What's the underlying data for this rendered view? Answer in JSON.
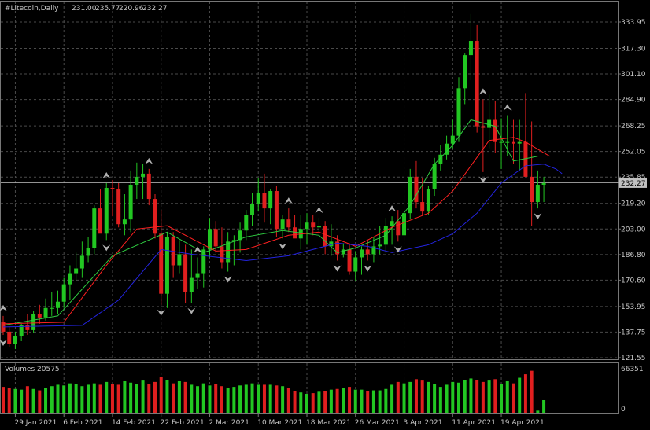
{
  "chart_data": {
    "type": "candlestick",
    "symbol_label": "#Litecoin,Daily",
    "ohlc_label": [
      "231.00",
      "235.77",
      "220.96",
      "232.27"
    ],
    "current_price_label": "232.27",
    "current_price": 232.27,
    "y_ticks": [
      "333.95",
      "317.30",
      "301.10",
      "284.90",
      "268.25",
      "252.05",
      "235.85",
      "219.20",
      "203.00",
      "186.80",
      "170.60",
      "153.95",
      "137.75",
      "121.55"
    ],
    "ylim": [
      121.55,
      333.95
    ],
    "x_labels": [
      "29 Jan 2021",
      "6 Feb 2021",
      "14 Feb 2021",
      "22 Feb 2021",
      "2 Mar 2021",
      "10 Mar 2021",
      "18 Mar 2021",
      "26 Mar 2021",
      "3 Apr 2021",
      "11 Apr 2021",
      "19 Apr 2021"
    ],
    "dates": [
      "2021-01-27",
      "2021-01-28",
      "2021-01-29",
      "2021-01-30",
      "2021-01-31",
      "2021-02-01",
      "2021-02-02",
      "2021-02-03",
      "2021-02-04",
      "2021-02-05",
      "2021-02-06",
      "2021-02-07",
      "2021-02-08",
      "2021-02-09",
      "2021-02-10",
      "2021-02-11",
      "2021-02-12",
      "2021-02-13",
      "2021-02-14",
      "2021-02-15",
      "2021-02-16",
      "2021-02-17",
      "2021-02-18",
      "2021-02-19",
      "2021-02-20",
      "2021-02-21",
      "2021-02-22",
      "2021-02-23",
      "2021-02-24",
      "2021-02-25",
      "2021-02-26",
      "2021-02-27",
      "2021-02-28",
      "2021-03-01",
      "2021-03-02",
      "2021-03-03",
      "2021-03-04",
      "2021-03-05",
      "2021-03-06",
      "2021-03-07",
      "2021-03-08",
      "2021-03-09",
      "2021-03-10",
      "2021-03-11",
      "2021-03-12",
      "2021-03-13",
      "2021-03-14",
      "2021-03-15",
      "2021-03-16",
      "2021-03-17",
      "2021-03-18",
      "2021-03-19",
      "2021-03-20",
      "2021-03-21",
      "2021-03-22",
      "2021-03-23",
      "2021-03-24",
      "2021-03-25",
      "2021-03-26",
      "2021-03-27",
      "2021-03-28",
      "2021-03-29",
      "2021-03-30",
      "2021-03-31",
      "2021-04-01",
      "2021-04-02",
      "2021-04-03",
      "2021-04-04",
      "2021-04-05",
      "2021-04-06",
      "2021-04-07",
      "2021-04-08",
      "2021-04-09",
      "2021-04-10",
      "2021-04-11",
      "2021-04-12",
      "2021-04-13",
      "2021-04-14",
      "2021-04-15",
      "2021-04-16",
      "2021-04-17",
      "2021-04-18",
      "2021-04-19",
      "2021-04-20",
      "2021-04-21",
      "2021-04-22",
      "2021-04-23",
      "2021-04-24",
      "2021-04-25",
      "2021-04-26"
    ],
    "open": [
      144,
      138,
      130,
      135,
      142,
      139,
      149,
      147,
      153,
      153,
      157,
      168,
      175,
      178,
      186,
      191,
      216,
      200,
      229,
      228,
      206,
      209,
      231,
      236,
      238,
      222,
      200,
      162,
      198,
      180,
      187,
      163,
      172,
      175,
      190,
      203,
      192,
      182,
      195,
      196,
      202,
      212,
      219,
      226,
      216,
      227,
      203,
      209,
      204,
      197,
      203,
      207,
      204,
      205,
      192,
      195,
      187,
      190,
      176,
      185,
      190,
      187,
      192,
      193,
      205,
      208,
      199,
      213,
      236,
      220,
      214,
      228,
      244,
      250,
      257,
      262,
      292,
      313,
      322,
      268,
      267,
      272,
      258,
      258,
      258,
      257,
      258,
      236,
      220,
      231
    ],
    "high": [
      148,
      141,
      138,
      143,
      149,
      151,
      155,
      159,
      163,
      164,
      172,
      180,
      188,
      195,
      198,
      218,
      228,
      232,
      234,
      232,
      225,
      240,
      245,
      244,
      241,
      225,
      215,
      201,
      201,
      196,
      193,
      190,
      185,
      192,
      210,
      208,
      204,
      201,
      199,
      207,
      215,
      226,
      235,
      238,
      228,
      230,
      212,
      216,
      212,
      212,
      213,
      212,
      210,
      208,
      206,
      199,
      194,
      194,
      189,
      192,
      196,
      198,
      205,
      210,
      211,
      215,
      224,
      241,
      246,
      235,
      230,
      248,
      256,
      262,
      272,
      299,
      314,
      339,
      332,
      285,
      288,
      284,
      273,
      275,
      272,
      272,
      289,
      271,
      240,
      236
    ],
    "low": [
      136,
      128,
      127,
      132,
      136,
      137,
      143,
      145,
      148,
      149,
      153,
      158,
      170,
      172,
      182,
      187,
      201,
      196,
      211,
      204,
      199,
      201,
      222,
      222,
      218,
      197,
      155,
      153,
      172,
      175,
      156,
      156,
      165,
      166,
      185,
      188,
      178,
      176,
      180,
      188,
      196,
      205,
      214,
      207,
      206,
      198,
      197,
      201,
      200,
      190,
      193,
      199,
      200,
      187,
      186,
      183,
      185,
      174,
      170,
      174,
      183,
      182,
      187,
      188,
      193,
      195,
      195,
      209,
      216,
      212,
      212,
      224,
      240,
      247,
      254,
      258,
      282,
      297,
      264,
      239,
      254,
      251,
      241,
      249,
      244,
      240,
      241,
      205,
      216,
      220
    ],
    "close": [
      138,
      130,
      135,
      142,
      139,
      149,
      147,
      153,
      153,
      157,
      168,
      175,
      178,
      186,
      191,
      216,
      200,
      229,
      228,
      206,
      209,
      231,
      236,
      238,
      222,
      200,
      162,
      198,
      180,
      187,
      163,
      172,
      175,
      190,
      203,
      192,
      182,
      195,
      196,
      202,
      212,
      219,
      226,
      216,
      227,
      203,
      209,
      204,
      197,
      203,
      207,
      204,
      205,
      192,
      195,
      187,
      190,
      176,
      185,
      190,
      187,
      192,
      193,
      205,
      208,
      199,
      213,
      236,
      220,
      214,
      228,
      244,
      250,
      257,
      262,
      292,
      313,
      322,
      268,
      267,
      272,
      258,
      258,
      258,
      257,
      258,
      236,
      220,
      231,
      232
    ],
    "ma_green": {
      "name": "",
      "color": "#2ecc40",
      "days": [
        0,
        9,
        18,
        27,
        33,
        40,
        46,
        52,
        55,
        58,
        63,
        67,
        71,
        74,
        77,
        81,
        84,
        88
      ],
      "values": [
        142,
        148,
        186,
        201,
        188,
        198,
        202,
        199,
        188,
        191,
        199,
        218,
        244,
        256,
        272,
        268,
        246,
        249
      ]
    },
    "ma_red": {
      "name": "",
      "color": "#ff2020",
      "days": [
        0,
        10,
        17,
        22,
        27,
        35,
        40,
        47,
        52,
        58,
        64,
        70,
        74,
        80,
        84,
        86,
        90
      ],
      "values": [
        143,
        144,
        180,
        203,
        205,
        189,
        190,
        199,
        201,
        192,
        204,
        213,
        227,
        259,
        261,
        258,
        249
      ]
    },
    "ma_blue": {
      "name": "",
      "color": "#2424e0",
      "days": [
        0,
        13,
        19,
        26,
        31,
        40,
        47,
        55,
        60,
        64,
        70,
        74,
        78,
        82,
        86,
        89,
        91,
        92
      ],
      "values": [
        141,
        142,
        158,
        190,
        187,
        183,
        186,
        194,
        192,
        188,
        193,
        200,
        213,
        232,
        243,
        244,
        241,
        238
      ]
    },
    "fractals_up_days": [
      0,
      17,
      24,
      32,
      47,
      52,
      64,
      79,
      83
    ],
    "fractals_down_days": [
      0,
      17,
      26,
      31,
      37,
      46,
      55,
      60,
      65,
      79,
      88
    ],
    "volume_label": "Volumes 20575",
    "volume_ticks": [
      "66351",
      "0"
    ],
    "volume_ylim": [
      0,
      66351
    ],
    "volumes": [
      37000,
      36000,
      34000,
      33000,
      38000,
      34000,
      32000,
      35000,
      38000,
      40000,
      39000,
      42000,
      41000,
      38000,
      40000,
      42000,
      40000,
      44000,
      41000,
      40000,
      45000,
      43000,
      41000,
      46000,
      41000,
      44000,
      51000,
      47000,
      42000,
      45000,
      44000,
      40000,
      38000,
      42000,
      39000,
      41000,
      38000,
      36000,
      37000,
      39000,
      40000,
      42000,
      40000,
      40000,
      40000,
      39000,
      38000,
      35000,
      31000,
      29000,
      27000,
      28000,
      30000,
      31000,
      33000,
      34000,
      36000,
      37000,
      33000,
      33000,
      31000,
      32000,
      32000,
      34000,
      40000,
      44000,
      42000,
      44000,
      48000,
      46000,
      44000,
      41000,
      37000,
      40000,
      44000,
      43000,
      47000,
      49000,
      47000,
      44000,
      46000,
      48000,
      41000,
      45000,
      42000,
      50000,
      55000,
      60000,
      3000,
      18000
    ]
  }
}
